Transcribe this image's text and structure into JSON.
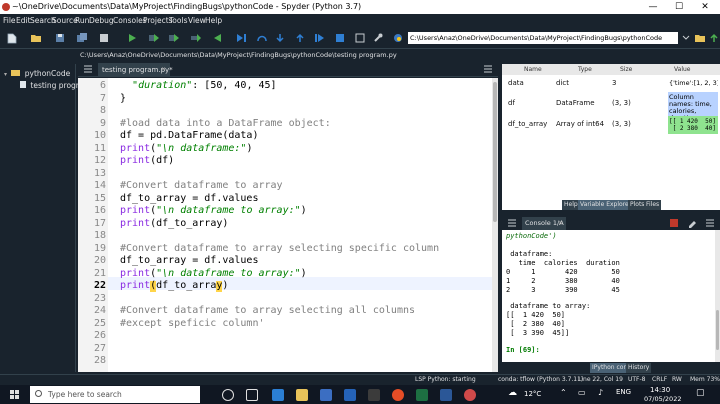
{
  "window": {
    "title": "~\\OneDrive\\Documents\\Data\\MyProject\\FindingBugs\\pythonCode - Spyder (Python 3.7)",
    "minimize": "—",
    "maximize": "☐",
    "close": "✕"
  },
  "menu": [
    "File",
    "Edit",
    "Search",
    "Source",
    "Run",
    "Debug",
    "Consoles",
    "Projects",
    "Tools",
    "View",
    "Help"
  ],
  "toolbar": {
    "working_dir": "C:\\Users\\Anaz\\OneDrive\\Documents\\Data\\MyProject\\FindingBugs\\pythonCode"
  },
  "file_explorer": {
    "root": "pythonCode",
    "file": "testing program.py"
  },
  "editor": {
    "path": "C:\\Users\\Anaz\\OneDrive\\Documents\\Data\\MyProject\\FindingBugs\\pythonCode\\testing program.py",
    "tab_label": "testing program.py*",
    "tab_close": "✕",
    "line_numbers": [
      "6",
      "7",
      "8",
      "9",
      "10",
      "11",
      "12",
      "13",
      "14",
      "15",
      "16",
      "17",
      "18",
      "19",
      "20",
      "21",
      "22",
      "23",
      "24",
      "25",
      "26",
      "27",
      "28"
    ],
    "current_line": "22",
    "lines": {
      "l6_key": "\"duration\"",
      "l6_rest": ": [50, 40, 45]",
      "l7": "}",
      "l9": "#load data into a DataFrame object:",
      "l10": "df = pd.DataFrame(data)",
      "l11_fn": "print",
      "l11_open": "(",
      "l11_str": "\"\\n dataframe:\"",
      "l11_close": ")",
      "l12_fn": "print",
      "l12_rest": "(df)",
      "l14": "#Convert dataframe to array",
      "l15": "df_to_array = df.values",
      "l16_fn": "print",
      "l16_open": "(",
      "l16_str": "\"\\n dataframe to array:\"",
      "l16_close": ")",
      "l17_fn": "print",
      "l17_rest": "(df_to_array)",
      "l19": "#Convert dataframe to array selecting specific column",
      "l20": "df_to_array = df.values",
      "l21_fn": "print",
      "l21_open": "(",
      "l21_str": "\"\\n dataframe to array:\"",
      "l21_close": ")",
      "l22_fn": "print",
      "l22_rest": "(df_to_array)",
      "l24": "#Convert dataframe to array selecting all columns",
      "l25": "#except speficic column'"
    }
  },
  "variable_explorer": {
    "headers": [
      "Name",
      "Type",
      "Size",
      "Value"
    ],
    "rows": [
      {
        "name": "data",
        "type": "dict",
        "size": "3",
        "value": "{'time':[1, 2, 3], ..."
      },
      {
        "name": "df",
        "type": "DataFrame",
        "size": "(3, 3)",
        "value": "Column names: time, calories, duration"
      },
      {
        "name": "df_to_array",
        "type": "Array of int64",
        "size": "(3, 3)",
        "value": "[[ 1 420  50]\n [ 2 380  40]"
      }
    ],
    "tabs": [
      "Help",
      "Variable Explorer",
      "Plots",
      "Files"
    ]
  },
  "console": {
    "tab_label": "Console 1/A",
    "tab_close": "✕",
    "lines": [
      "pythonCode')",
      "",
      " dataframe:",
      "   time  calories  duration",
      "0     1       420        50",
      "1     2       380        40",
      "2     3       390        45",
      "",
      " dataframe to array:",
      "[[  1 420  50]",
      " [  2 380  40]",
      " [  3 390  45]]",
      "",
      "In [69]:"
    ],
    "tabs": [
      "IPython console",
      "History"
    ]
  },
  "status_bar": {
    "lsp": "LSP Python: starting",
    "conda": "conda: tflow (Python 3.7.11)",
    "position": "Line 22, Col 19",
    "encoding": "UTF-8",
    "eol": "CRLF",
    "rw": "RW",
    "mem": "Mem 73%"
  },
  "taskbar": {
    "search_placeholder": "Type here to search",
    "temperature": "12°C",
    "time": "14:30",
    "date": "07/05/2022"
  },
  "colors": {
    "ide_background": "#19232d",
    "editor_background": "#ffffff",
    "comment": "#808080",
    "string": "#008000",
    "builtin": "#8a2be2"
  }
}
